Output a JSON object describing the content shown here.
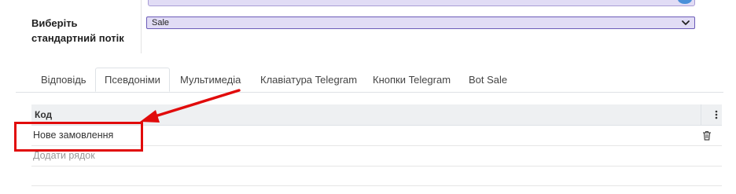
{
  "form": {
    "field_label": "Виберіть стандартний потік",
    "stream_select_value": "Sale"
  },
  "tabs": [
    {
      "label": "Відповідь"
    },
    {
      "label": "Псевдоніми"
    },
    {
      "label": "Мультимедіа"
    },
    {
      "label": "Клавіатура Telegram"
    },
    {
      "label": "Кнопки Telegram"
    },
    {
      "label": "Bot Sale"
    }
  ],
  "active_tab": "Псевдоніми",
  "table": {
    "column_header": "Код",
    "rows": [
      {
        "code": "Нове замовлення"
      }
    ],
    "add_row_label": "Додати рядок"
  },
  "colors": {
    "select_bg": "#e1dcf5",
    "select_border": "#6b5bb8",
    "annotation_red": "#e10b0b"
  },
  "icons": [
    "chevron-down-icon",
    "kebab-menu-icon",
    "trash-icon",
    "annotation-arrow"
  ]
}
